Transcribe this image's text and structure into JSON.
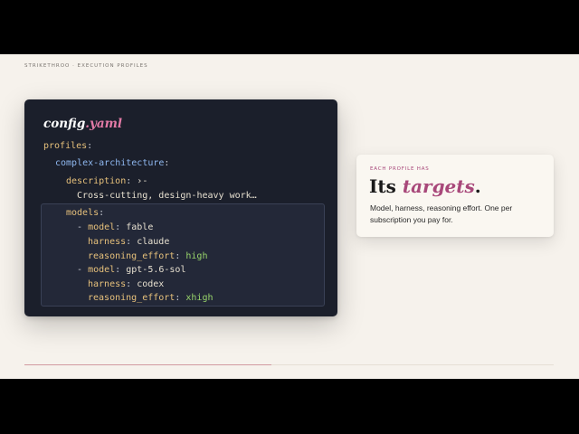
{
  "breadcrumb": "STRIKETHROO · EXECUTION PROFILES",
  "code": {
    "file_name": "config",
    "file_ext": ".yaml",
    "lines": {
      "profiles_key": "profiles",
      "colon": ":",
      "profile_name": "complex-architecture",
      "description_key": "description",
      "description_marker": "›-",
      "description_value": "Cross-cutting, design-heavy work…",
      "models_key": "models",
      "dash": "-",
      "model_key": "model",
      "harness_key": "harness",
      "effort_key": "reasoning_effort",
      "model1": {
        "model": "fable",
        "harness": "claude",
        "effort": "high"
      },
      "model2": {
        "model": "gpt-5.6-sol",
        "harness": "codex",
        "effort": "xhigh"
      }
    }
  },
  "card": {
    "eyebrow": "EACH PROFILE HAS",
    "headline_prefix": "Its ",
    "headline_accent": "targets",
    "headline_suffix": ".",
    "description": "Model, harness, reasoning effort. One per subscription you pay for."
  },
  "progress": {
    "fraction": 0.467
  },
  "colors": {
    "accent": "#a8487a",
    "code_bg": "#1b1f2b",
    "page_bg": "#f6f2ec"
  }
}
